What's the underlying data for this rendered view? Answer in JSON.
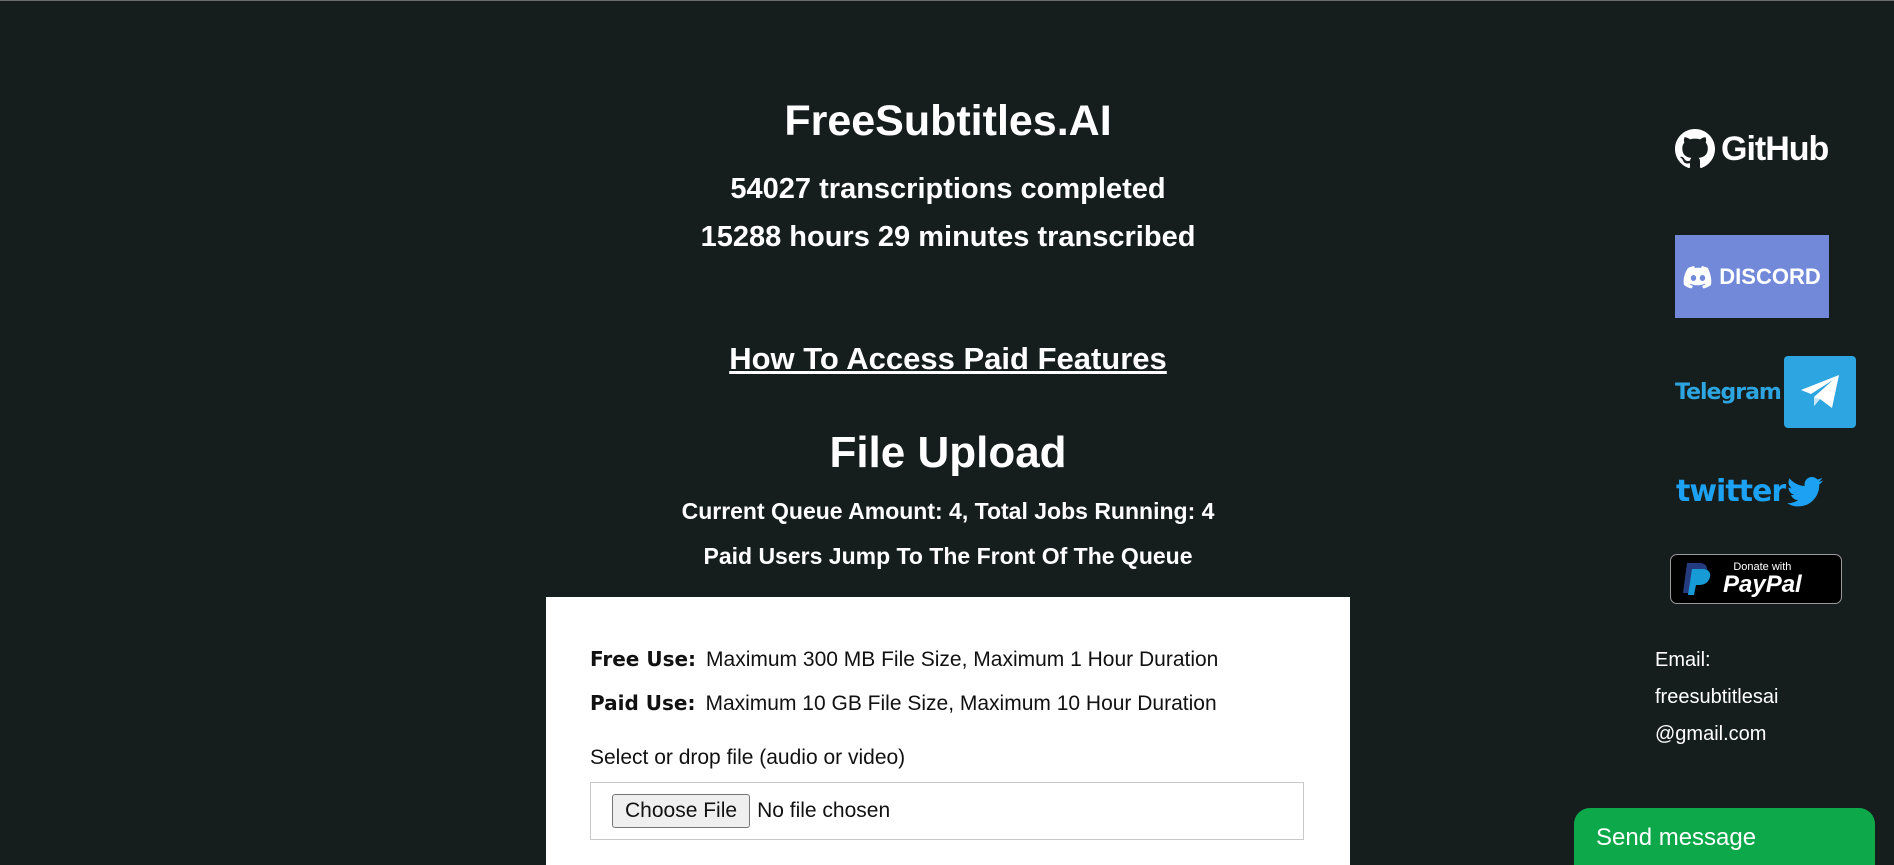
{
  "header": {
    "site_title": "FreeSubtitles.AI",
    "transcriptions_completed": "54027 transcriptions completed",
    "hours_transcribed": "15288 hours 29 minutes transcribed"
  },
  "paid_link": "How To Access Paid Features",
  "upload": {
    "title": "File Upload",
    "queue_status": "Current Queue Amount: 4, Total Jobs Running: 4",
    "paid_jump": "Paid Users Jump To The Front Of The Queue",
    "free_label": "Free Use:",
    "free_limits": "Maximum 300 MB File Size, Maximum 1 Hour Duration",
    "paid_label": "Paid Use:",
    "paid_limits": "Maximum 10 GB File Size, Maximum 10 Hour Duration",
    "select_label": "Select or drop file (audio or video)",
    "choose_button": "Choose File",
    "no_file": "No file chosen"
  },
  "sidebar": {
    "github": "GitHub",
    "discord": "DISCORD",
    "telegram": "Telegram",
    "twitter": "twitter",
    "paypal_donate": "Donate with",
    "paypal_name": "PayPal",
    "email_label": "Email:",
    "email_line1": "freesubtitlesai",
    "email_line2": "@gmail.com"
  },
  "chat": {
    "send_message": "Send message"
  },
  "colors": {
    "background": "#161d1d",
    "discord": "#7289da",
    "telegram": "#2ca5e0",
    "twitter": "#1da1f2",
    "send_message": "#0ca84a"
  }
}
